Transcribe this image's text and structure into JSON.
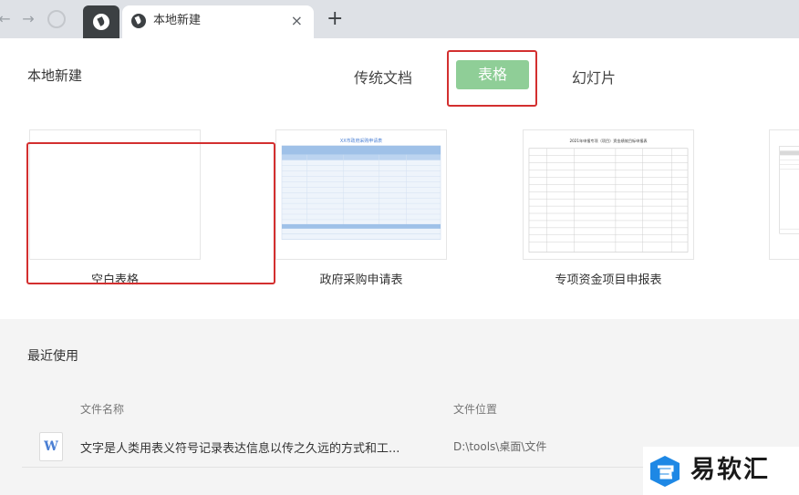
{
  "browser": {
    "back": "←",
    "forward": "→",
    "reload": "↻",
    "tab_title": "本地新建",
    "close": "×",
    "new_tab": "+"
  },
  "header": {
    "title": "本地新建",
    "tabs": [
      "传统文档",
      "表格",
      "幻灯片"
    ],
    "active_tab": "表格"
  },
  "templates": [
    {
      "label": "空白表格"
    },
    {
      "label": "政府采购申请表",
      "preview_title": "XX市政府采购申请表"
    },
    {
      "label": "专项资金项目申报表",
      "preview_title": "2021年申报专项（项目）资金绩效目标申报表"
    }
  ],
  "recent": {
    "title": "最近使用",
    "columns": [
      "文件名称",
      "文件位置"
    ],
    "files": [
      {
        "icon": "W",
        "name": "文字是人类用表义符号记录表达信息以传之久远的方式和工...",
        "path": "D:\\tools\\桌面\\文件"
      }
    ]
  },
  "watermark": {
    "text": "易软汇"
  },
  "colors": {
    "accent": "#8fce97",
    "highlight": "#d32f2f",
    "tab_dark": "#3c4043"
  }
}
